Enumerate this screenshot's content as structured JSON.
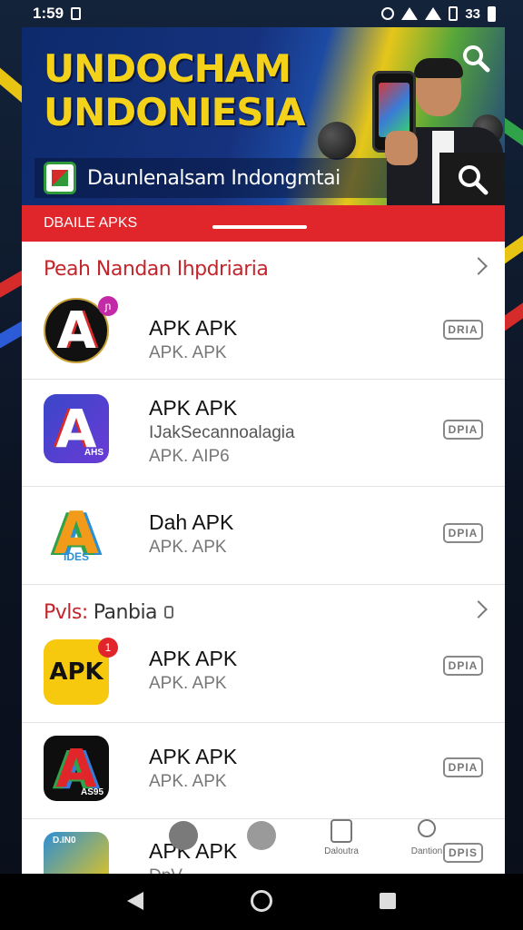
{
  "status_bar": {
    "time": "1:59",
    "battery": "33"
  },
  "hero": {
    "title_line1": "UNDOCHAM",
    "title_line2": "UNDONIESIA",
    "subtitle": "Daunlenalsam Indongmtai"
  },
  "red_bar": {
    "label": "DBAILE APKS"
  },
  "sections": [
    {
      "title_red": "Peah Nandan Ihpdriaria",
      "title_rest": "",
      "apps": [
        {
          "name": "APK APK",
          "subtitle": "",
          "detail": "APK. APK",
          "badge": "DRIA",
          "notify": "ɲ"
        },
        {
          "name": "APK APK",
          "subtitle": "IJakSecannoalagia",
          "detail": "APK. AIP6",
          "badge": "DPIA",
          "icon_text": "AHS"
        },
        {
          "name": "Dah APK",
          "subtitle": "",
          "detail": "APK. APK",
          "badge": "DPIA",
          "icon_text": "IDES"
        }
      ]
    },
    {
      "title_red": "Pvls:",
      "title_rest": "Panbia",
      "apps": [
        {
          "name": "APK APK",
          "subtitle": "",
          "detail": "APK. APK",
          "badge": "DPIA",
          "icon_text": "APK",
          "notify": "1"
        },
        {
          "name": "APK APK",
          "subtitle": "",
          "detail": "APK. APK",
          "badge": "DPIA",
          "icon_text": "AS95"
        },
        {
          "name": "APK APK",
          "subtitle": "",
          "detail": "DnV",
          "badge": "DPIS",
          "icon_text": "D.IN0"
        }
      ]
    }
  ],
  "tabs": [
    {
      "label": ""
    },
    {
      "label": ""
    },
    {
      "label": "Daloutra"
    },
    {
      "label": "Dantion"
    }
  ]
}
